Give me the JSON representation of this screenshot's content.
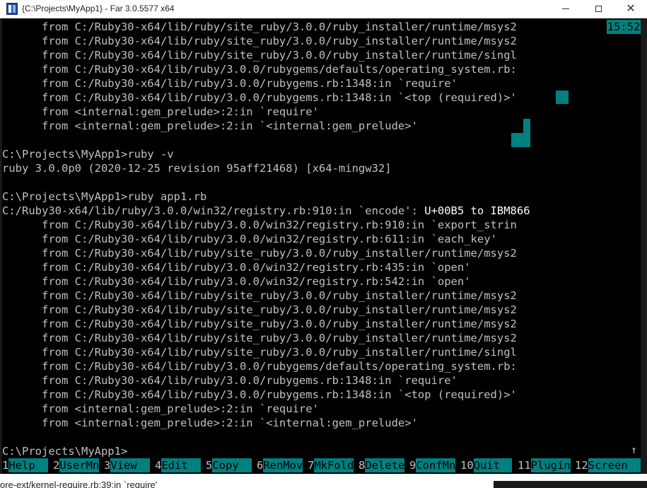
{
  "window": {
    "title": "{C:\\Projects\\MyApp1} - Far 3.0.5577 x64",
    "minimize_glyph": "—",
    "maximize_glyph": "☐",
    "close_glyph": "✕"
  },
  "console": {
    "clock": "15:52",
    "lines": [
      "      from C:/Ruby30-x64/lib/ruby/site_ruby/3.0.0/ruby_installer/runtime/msys2",
      "      from C:/Ruby30-x64/lib/ruby/site_ruby/3.0.0/ruby_installer/runtime/msys2",
      "      from C:/Ruby30-x64/lib/ruby/site_ruby/3.0.0/ruby_installer/runtime/singl",
      "      from C:/Ruby30-x64/lib/ruby/3.0.0/rubygems/defaults/operating_system.rb:",
      "      from C:/Ruby30-x64/lib/ruby/3.0.0/rubygems.rb:1348:in `require'",
      "      from C:/Ruby30-x64/lib/ruby/3.0.0/rubygems.rb:1348:in `<top (required)>'",
      "      from <internal:gem_prelude>:2:in `require'",
      "      from <internal:gem_prelude>:2:in `<internal:gem_prelude>'",
      "",
      "C:\\Projects\\MyApp1>ruby -v",
      "ruby 3.0.0p0 (2020-12-25 revision 95aff21468) [x64-mingw32]",
      "",
      "C:\\Projects\\MyApp1>ruby app1.rb",
      "C:/Ruby30-x64/lib/ruby/3.0.0/win32/registry.rb:910:in `encode': ",
      "      from C:/Ruby30-x64/lib/ruby/3.0.0/win32/registry.rb:910:in `export_strin",
      "      from C:/Ruby30-x64/lib/ruby/3.0.0/win32/registry.rb:611:in `each_key'",
      "      from C:/Ruby30-x64/lib/ruby/site_ruby/3.0.0/ruby_installer/runtime/msys2",
      "      from C:/Ruby30-x64/lib/ruby/3.0.0/win32/registry.rb:435:in `open'",
      "      from C:/Ruby30-x64/lib/ruby/3.0.0/win32/registry.rb:542:in `open'",
      "      from C:/Ruby30-x64/lib/ruby/site_ruby/3.0.0/ruby_installer/runtime/msys2",
      "      from C:/Ruby30-x64/lib/ruby/site_ruby/3.0.0/ruby_installer/runtime/msys2",
      "      from C:/Ruby30-x64/lib/ruby/site_ruby/3.0.0/ruby_installer/runtime/msys2",
      "      from C:/Ruby30-x64/lib/ruby/site_ruby/3.0.0/ruby_installer/runtime/msys2",
      "      from C:/Ruby30-x64/lib/ruby/site_ruby/3.0.0/ruby_installer/runtime/singl",
      "      from C:/Ruby30-x64/lib/ruby/3.0.0/rubygems/defaults/operating_system.rb:",
      "      from C:/Ruby30-x64/lib/ruby/3.0.0/rubygems.rb:1348:in `require'",
      "      from C:/Ruby30-x64/lib/ruby/3.0.0/rubygems.rb:1348:in `<top (required)>'",
      "      from <internal:gem_prelude>:2:in `require'",
      "      from <internal:gem_prelude>:2:in `<internal:gem_prelude>'",
      "",
      "C:\\Projects\\MyApp1>"
    ],
    "error_highlight": "U+00B5 to IBM866",
    "scroll_arrow": "↑"
  },
  "keybar": [
    {
      "num": "1",
      "label": "Help"
    },
    {
      "num": "2",
      "label": "UserMn"
    },
    {
      "num": "3",
      "label": "View"
    },
    {
      "num": "4",
      "label": "Edit"
    },
    {
      "num": "5",
      "label": "Copy"
    },
    {
      "num": "6",
      "label": "RenMov"
    },
    {
      "num": "7",
      "label": "MkFold"
    },
    {
      "num": "8",
      "label": "Delete"
    },
    {
      "num": "9",
      "label": "ConfMn"
    },
    {
      "num": "10",
      "label": "Quit"
    },
    {
      "num": "11",
      "label": "Plugin"
    },
    {
      "num": "12",
      "label": "Screen"
    }
  ],
  "below_window_text": "ore-ext/kernel-require.rb:39:in `require'",
  "colors": {
    "console_bg": "#000000",
    "console_fg": "#c0c0c0",
    "accent_teal": "#008080",
    "highlight_fg": "#ffffff"
  }
}
